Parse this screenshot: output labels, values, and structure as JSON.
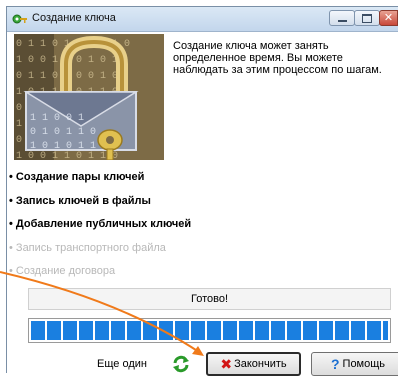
{
  "window": {
    "title": "Создание ключа"
  },
  "intro": {
    "text": "Создание ключа может занять определенное время. Вы можете наблюдать за этим процессом по шагам."
  },
  "steps": [
    {
      "label": "Создание пары ключей",
      "state": "done"
    },
    {
      "label": "Запись ключей в файлы",
      "state": "done"
    },
    {
      "label": "Добавление публичных ключей",
      "state": "done"
    },
    {
      "label": "Запись транспортного файла",
      "state": "pending"
    },
    {
      "label": "Создание договора",
      "state": "pending"
    }
  ],
  "status": {
    "text": "Готово!"
  },
  "progress": {
    "fraction": 1.0,
    "color": "#1a7fe0"
  },
  "footer": {
    "once_more_label": "Еще один",
    "finish_label": "Закончить",
    "help_label": "Помощь"
  },
  "colors": {
    "annotation": "#f07a1a",
    "finish_icon": "#d21616",
    "help_icon": "#1c6fd1"
  }
}
